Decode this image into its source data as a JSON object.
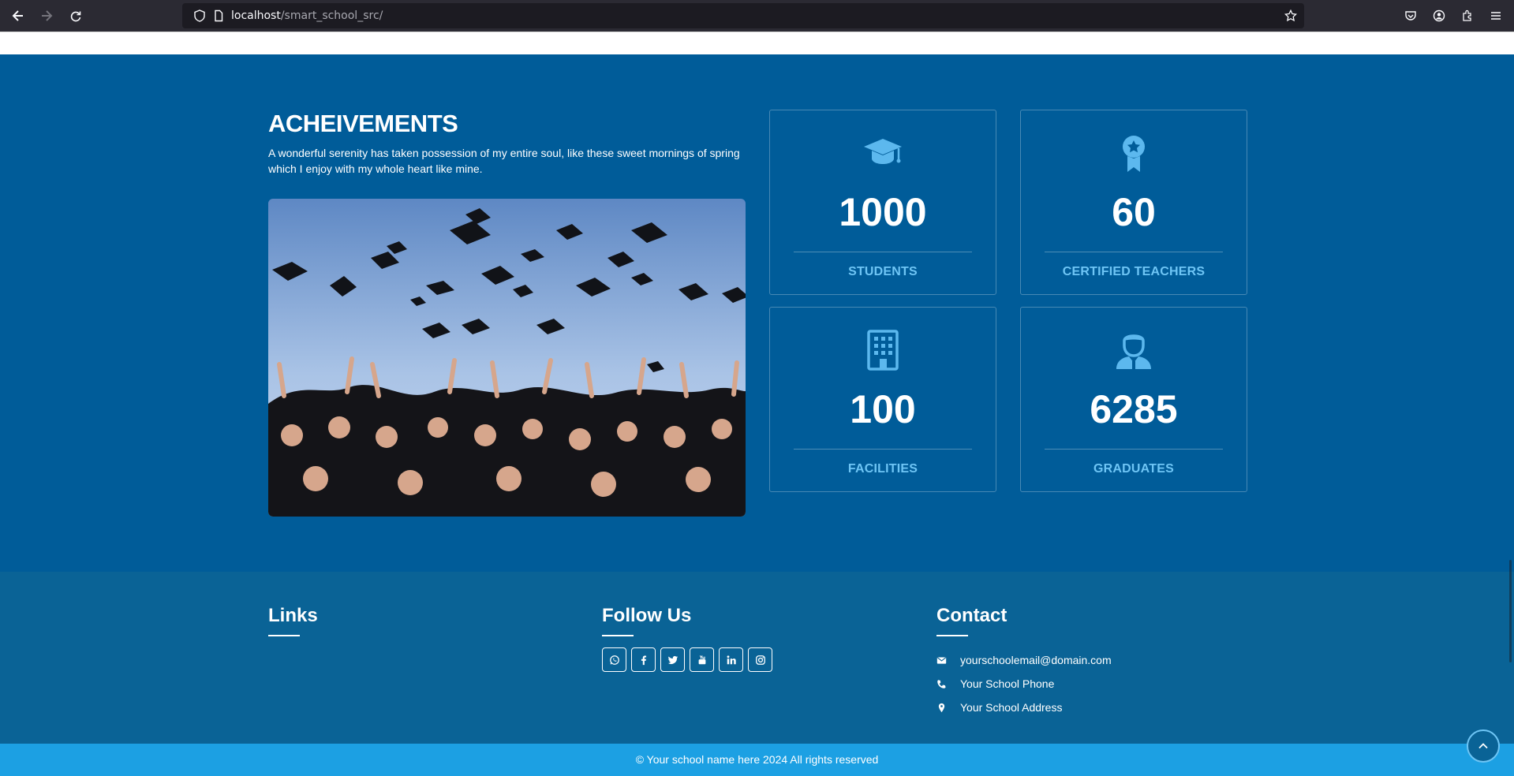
{
  "browser": {
    "url_host": "localhost",
    "url_path": "/smart_school_src/"
  },
  "achievements": {
    "title": "ACHEIVEMENTS",
    "description": "A wonderful serenity has taken possession of my entire soul, like these sweet mornings of spring which I enjoy with my whole heart like mine.",
    "stats": [
      {
        "icon": "graduation-cap-icon",
        "value": "1000",
        "label": "STUDENTS"
      },
      {
        "icon": "award-ribbon-icon",
        "value": "60",
        "label": "CERTIFIED TEACHERS"
      },
      {
        "icon": "building-icon",
        "value": "100",
        "label": "FACILITIES"
      },
      {
        "icon": "graduate-user-icon",
        "value": "6285",
        "label": "GRADUATES"
      }
    ]
  },
  "footer": {
    "links_heading": "Links",
    "follow_heading": "Follow Us",
    "contact_heading": "Contact",
    "social": [
      "whatsapp-icon",
      "facebook-icon",
      "twitter-icon",
      "youtube-icon",
      "linkedin-icon",
      "instagram-icon"
    ],
    "contact": {
      "email": "yourschoolemail@domain.com",
      "phone": "Your School Phone",
      "address": "Your School Address"
    },
    "copyright": "© Your school name here 2024 All rights reserved"
  },
  "colors": {
    "section_bg": "#005c99",
    "footer_bg": "#0a6396",
    "copyright_bg": "#1ca0e3",
    "accent": "#6ec5f5"
  }
}
